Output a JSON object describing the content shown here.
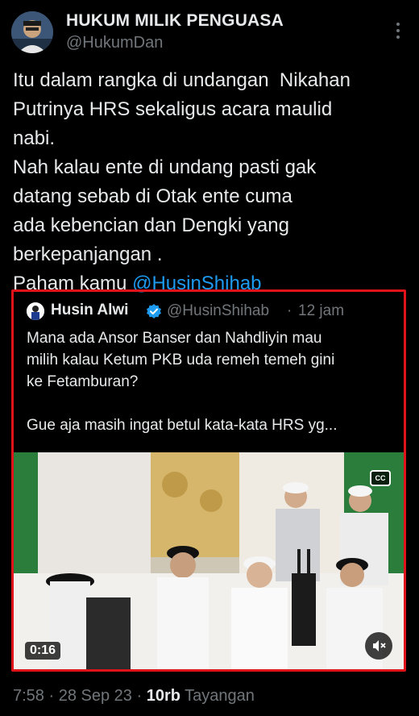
{
  "author": {
    "name": "HUKUM MILIK PENGUASA",
    "handle": "@HukumDan",
    "avatar_icon": "avatar-photo"
  },
  "tweet": {
    "lines": [
      "Itu dalam rangka di undangan  Nikahan",
      "Putrinya HRS sekaligus acara maulid",
      "nabi.",
      "Nah kalau ente di undang pasti gak",
      "datang sebab di Otak ente cuma",
      "ada kebencian dan Dengki yang",
      "berkepanjangan .",
      "Paham kamu "
    ],
    "mention": "@HusinShihab"
  },
  "quote": {
    "name": "Husin Alwi",
    "handle": "@HusinShihab",
    "separator": "·",
    "time": "12 jam",
    "text_lines": [
      "Mana ada Ansor Banser dan Nahdliyin mau",
      "milih kalau Ketum PKB uda remeh temeh gini",
      "ke Fetamburan?",
      "",
      "Gue aja masih ingat betul kata-kata HRS yg..."
    ],
    "video": {
      "duration": "0:16",
      "cc_label": "CC"
    },
    "highlight_color": "#e0131b"
  },
  "meta": {
    "time": "7:58",
    "sep1": " · ",
    "date": "28 Sep 23",
    "sep2": " · ",
    "views": "10rb",
    "views_label": " Tayangan"
  },
  "colors": {
    "background": "#000000",
    "text": "#e7e9ea",
    "muted": "#71767b",
    "link": "#1d9bf0",
    "verified": "#1d9bf0"
  }
}
